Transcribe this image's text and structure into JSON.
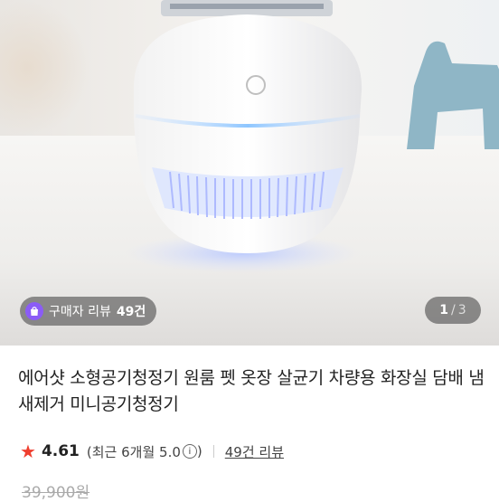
{
  "gallery": {
    "review_badge": {
      "label": "구매자 리뷰",
      "count": "49건"
    },
    "page_indicator": {
      "current": "1",
      "separator": "/",
      "total": "3"
    }
  },
  "product": {
    "title": "에어샷 소형공기청정기 원룸 펫 옷장 살균기 차량용 화장실 담배 냄새제거 미니공기청정기",
    "rating": "4.61",
    "rating_period_open": "(최근 6개월 5.0",
    "rating_info_icon": "ⓘ",
    "rating_period_close": ")",
    "review_link": "49건 리뷰",
    "original_price": "39,900원"
  },
  "colors": {
    "star": "#ef3e2e",
    "review_icon": "#8b5cf6",
    "led": "#7fb8ff"
  },
  "icons": [
    "review-bag-icon",
    "star-icon",
    "info-icon"
  ]
}
